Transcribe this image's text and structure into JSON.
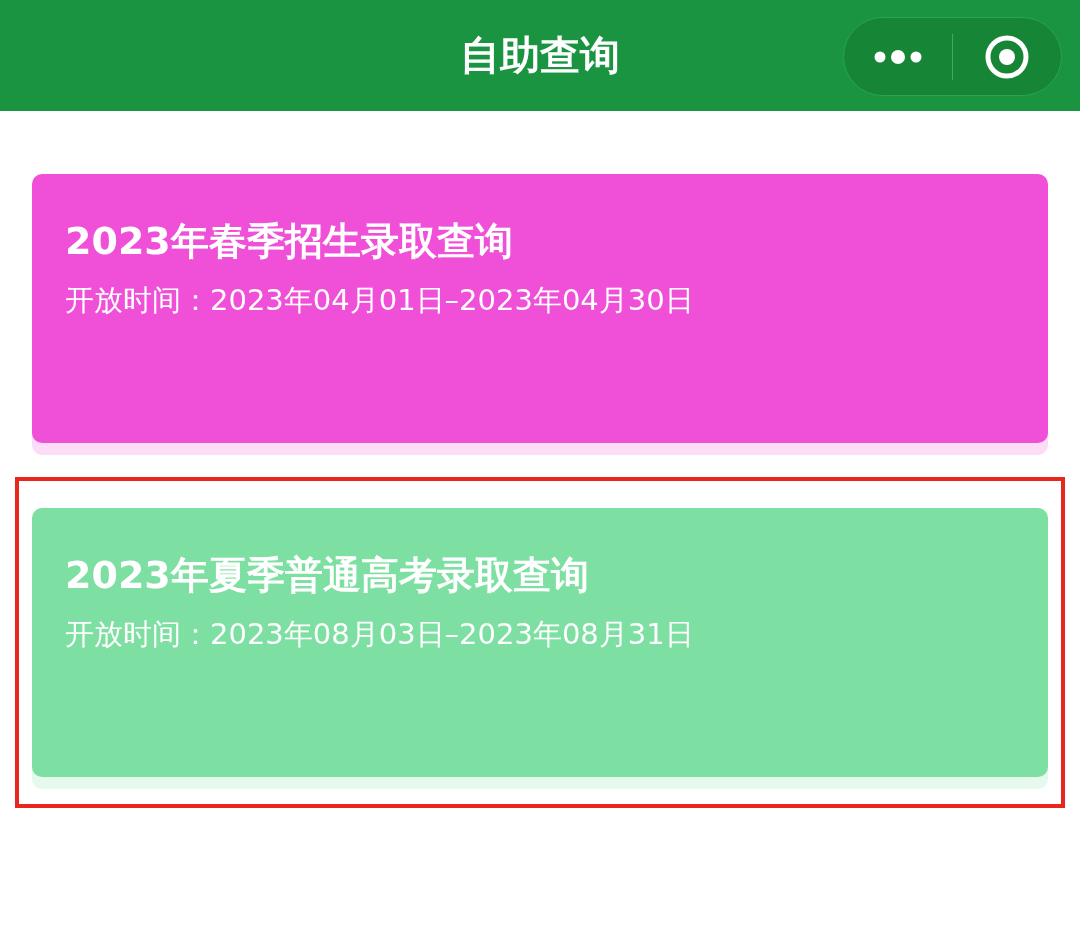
{
  "header": {
    "title": "自助查询"
  },
  "cards": [
    {
      "title": "2023年春季招生录取查询",
      "period": "开放时间：2023年04月01日–2023年04月30日",
      "color": "#f050d8",
      "highlighted": false
    },
    {
      "title": "2023年夏季普通高考录取查询",
      "period": "开放时间：2023年08月03日–2023年08月31日",
      "color": "#7ddfa2",
      "highlighted": true
    }
  ]
}
